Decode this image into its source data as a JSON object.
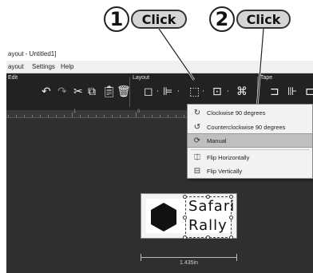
{
  "callouts": [
    {
      "number": "1",
      "label": "Click"
    },
    {
      "number": "2",
      "label": "Click"
    }
  ],
  "window": {
    "title": "ayout - Untitled1]"
  },
  "menu": {
    "items": [
      "ayout",
      "Settings",
      "Help"
    ]
  },
  "ribbon": {
    "groups": [
      "Edit",
      "Layout",
      "Tape"
    ]
  },
  "ruler": {
    "labels": [
      "1",
      "0"
    ]
  },
  "dropdown": {
    "items": [
      {
        "label": "Clockwise 90 degrees",
        "icon": "rotate-clockwise-icon"
      },
      {
        "label": "Counterclockwise 90 degrees",
        "icon": "rotate-counterclockwise-icon"
      },
      {
        "label": "Manual",
        "icon": "manual-rotate-icon",
        "selected": true
      },
      {
        "label": "Flip Horizontally",
        "icon": "flip-horizontal-icon"
      },
      {
        "label": "Flip Vertically",
        "icon": "flip-vertical-icon"
      }
    ]
  },
  "label": {
    "line1": "Safari",
    "line2": "Rally",
    "width": "1.435in",
    "shape": "hexagon"
  },
  "colors": {
    "app_background": "#2f2f2f",
    "ribbon": "#222222",
    "menu_highlight": "#bfbfbf",
    "callout_pill": "#d5d5d5"
  }
}
